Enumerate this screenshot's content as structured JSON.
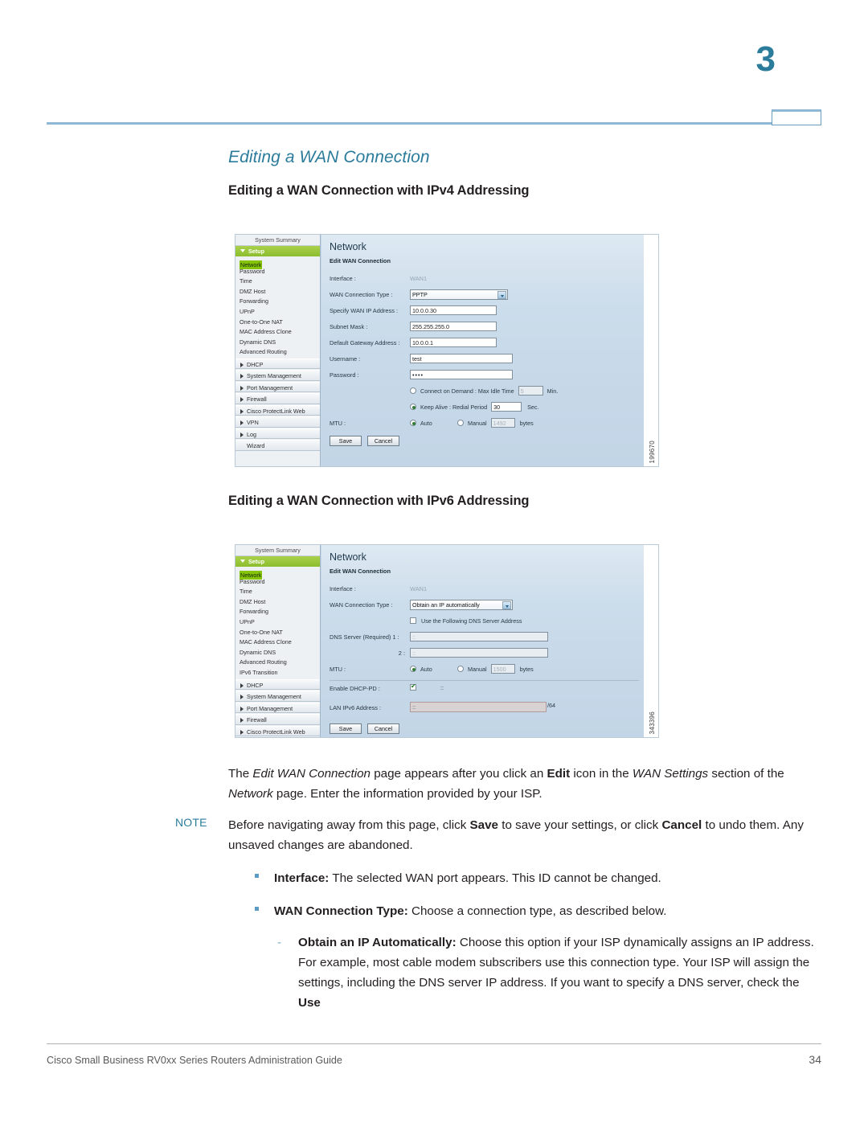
{
  "header": {
    "chapter_number": "3"
  },
  "headings": {
    "section": "Editing a WAN Connection",
    "sub_ipv4": "Editing a WAN Connection with IPv4 Addressing",
    "sub_ipv6": "Editing a WAN Connection with IPv6 Addressing"
  },
  "screenshot_ipv4": {
    "figure_id": "199670",
    "sidebar": {
      "top_item": "System Summary",
      "group_open": "Setup",
      "selected_item": "Network",
      "items": [
        "Password",
        "Time",
        "DMZ Host",
        "Forwarding",
        "UPnP",
        "One-to-One NAT",
        "MAC Address Clone",
        "Dynamic DNS",
        "Advanced Routing"
      ],
      "groups": [
        "DHCP",
        "System Management",
        "Port Management",
        "Firewall",
        "Cisco ProtectLink Web",
        "VPN",
        "Log"
      ],
      "plain_items": [
        "Wizard"
      ]
    },
    "panel": {
      "title": "Network",
      "subtitle": "Edit WAN Connection",
      "interface_label": "Interface :",
      "interface_value": "WAN1",
      "conn_type_label": "WAN Connection Type :",
      "conn_type_value": "PPTP",
      "wan_ip_label": "Specify WAN IP Address :",
      "wan_ip_value": "10.0.0.30",
      "subnet_label": "Subnet Mask :",
      "subnet_value": "255.255.255.0",
      "gateway_label": "Default Gateway Address :",
      "gateway_value": "10.0.0.1",
      "username_label": "Username :",
      "username_value": "test",
      "password_label": "Password :",
      "password_value": "••••",
      "connect_on_demand_label": "Connect on Demand : Max Idle Time",
      "max_idle_value": "5",
      "min_unit": "Min.",
      "keep_alive_label": "Keep Alive : Redial Period",
      "redial_value": "30",
      "sec_unit": "Sec.",
      "mtu_label": "MTU :",
      "mtu_auto_label": "Auto",
      "mtu_manual_label": "Manual",
      "mtu_manual_value": "1492",
      "bytes_unit": "bytes",
      "save_label": "Save",
      "cancel_label": "Cancel"
    }
  },
  "screenshot_ipv6": {
    "figure_id": "343396",
    "sidebar": {
      "top_item": "System Summary",
      "group_open": "Setup",
      "selected_item": "Network",
      "items": [
        "Password",
        "Time",
        "DMZ Host",
        "Forwarding",
        "UPnP",
        "One-to-One NAT",
        "MAC Address Clone",
        "Dynamic DNS",
        "Advanced Routing",
        "IPv6 Transition"
      ],
      "groups": [
        "DHCP",
        "System Management",
        "Port Management",
        "Firewall",
        "Cisco ProtectLink Web"
      ],
      "plain_items": []
    },
    "panel": {
      "title": "Network",
      "subtitle": "Edit WAN Connection",
      "interface_label": "Interface :",
      "interface_value": "WAN1",
      "conn_type_label": "WAN Connection Type :",
      "conn_type_value": "Obtain an IP automatically",
      "use_dns_label": "Use the Following DNS Server Address",
      "dns1_label": "DNS Server (Required) 1 :",
      "dns1_value": "::",
      "dns2_label": "2 :",
      "dns2_value": "::",
      "mtu_label": "MTU :",
      "mtu_auto_label": "Auto",
      "mtu_manual_label": "Manual",
      "mtu_manual_value": "1500",
      "bytes_unit": "bytes",
      "enable_dhcppd_label": "Enable DHCP-PD :",
      "enable_dhcppd_value": "::",
      "lan_ipv6_label": "LAN IPv6 Address :",
      "lan_ipv6_value": "::",
      "prefix_suffix": "/64",
      "save_label": "Save",
      "cancel_label": "Cancel"
    }
  },
  "body": {
    "note_label": "NOTE"
  },
  "footer": {
    "left": "Cisco Small Business RV0xx Series Routers Administration Guide",
    "page": "34"
  }
}
